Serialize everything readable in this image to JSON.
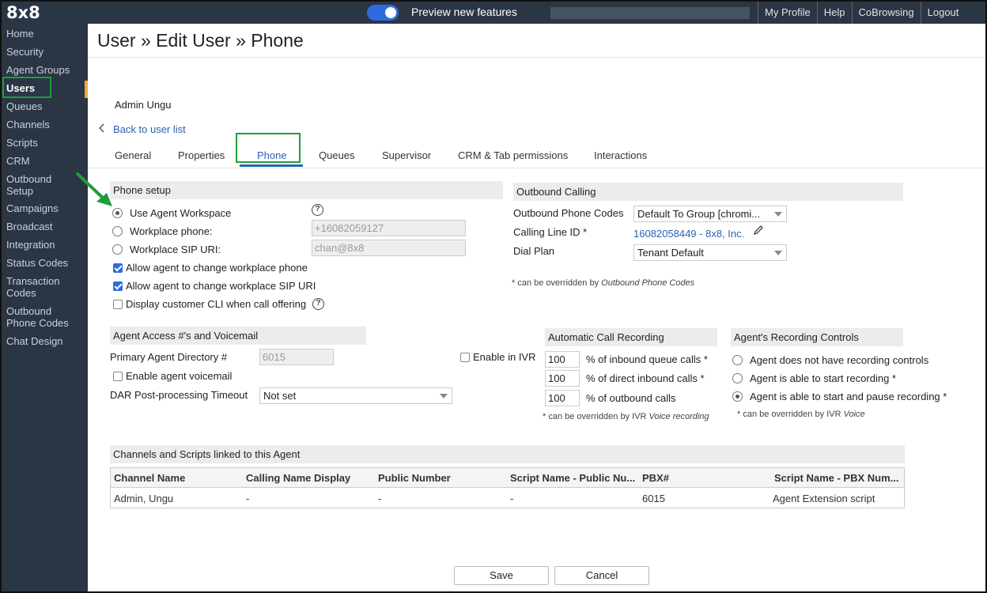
{
  "app": {
    "logo": "8x8",
    "preview_label": "Preview new features",
    "top_links": [
      "My Profile",
      "Help",
      "CoBrowsing",
      "Logout"
    ]
  },
  "sidebar": {
    "items": [
      "Home",
      "Security",
      "Agent Groups",
      "Users",
      "Queues",
      "Channels",
      "Scripts",
      "CRM",
      "Outbound Setup",
      "Campaigns",
      "Broadcast",
      "Integration",
      "Status Codes",
      "Transaction Codes",
      "Outbound Phone Codes",
      "Chat Design"
    ],
    "active": "Users"
  },
  "page": {
    "title": "User » Edit User » Phone",
    "user_name": "Admin Ungu",
    "back_link": "Back to user list"
  },
  "tabs": [
    "General",
    "Properties",
    "Phone",
    "Queues",
    "Supervisor",
    "CRM & Tab permissions",
    "Interactions"
  ],
  "phone_setup": {
    "title": "Phone setup",
    "use_agent_workspace": "Use Agent Workspace",
    "workplace_phone_label": "Workplace phone:",
    "workplace_phone_value": "+16082059127",
    "workplace_sip_label": "Workplace SIP URI:",
    "workplace_sip_value": "chan@8x8",
    "allow_phone": "Allow agent to change workplace phone",
    "allow_sip": "Allow agent to change workplace SIP URI",
    "display_cli": "Display customer CLI when call offering"
  },
  "outbound": {
    "title": "Outbound Calling",
    "phone_codes_label": "Outbound Phone Codes",
    "phone_codes_value": "Default To Group [chromi...",
    "calling_line_label": "Calling Line ID *",
    "calling_line_value": "16082058449 - 8x8, Inc.",
    "dial_plan_label": "Dial Plan",
    "dial_plan_value": "Tenant Default",
    "note_prefix": "* can be overridden by",
    "note_italic": "Outbound Phone Codes"
  },
  "access": {
    "title": "Agent Access #'s and Voicemail",
    "primary_label": "Primary Agent Directory #",
    "primary_value": "6015",
    "enable_ivr": "Enable in IVR",
    "enable_voicemail": "Enable agent voicemail",
    "dar_label": "DAR Post-processing Timeout",
    "dar_value": "Not set"
  },
  "recording": {
    "title": "Automatic Call Recording",
    "inbound_queue_value": "100",
    "inbound_queue_label": "% of inbound queue calls *",
    "direct_inbound_value": "100",
    "direct_inbound_label": "% of direct inbound calls *",
    "outbound_value": "100",
    "outbound_label": "% of outbound calls",
    "note_prefix": "* can be overridden by IVR",
    "note_italic": "Voice recording"
  },
  "controls": {
    "title": "Agent's Recording Controls",
    "none": "Agent does not have recording controls",
    "start": "Agent is able to start recording *",
    "start_pause": "Agent is able to start and pause recording *",
    "note_prefix": "* can be overridden by IVR",
    "note_italic": "Voice"
  },
  "channels": {
    "title": "Channels and Scripts linked to this Agent",
    "headers": [
      "Channel Name",
      "Calling Name Display",
      "Public Number",
      "Script Name - Public Nu...",
      "PBX#",
      "Script Name - PBX Num..."
    ],
    "rows": [
      [
        "Admin, Ungu",
        "-",
        "-",
        "-",
        "6015",
        "Agent Extension script"
      ]
    ]
  },
  "buttons": {
    "save": "Save",
    "cancel": "Cancel"
  },
  "colors": {
    "sidebar_bg": "#2b3645",
    "accent": "#2b62b5",
    "highlight": "#1e9e3a"
  }
}
